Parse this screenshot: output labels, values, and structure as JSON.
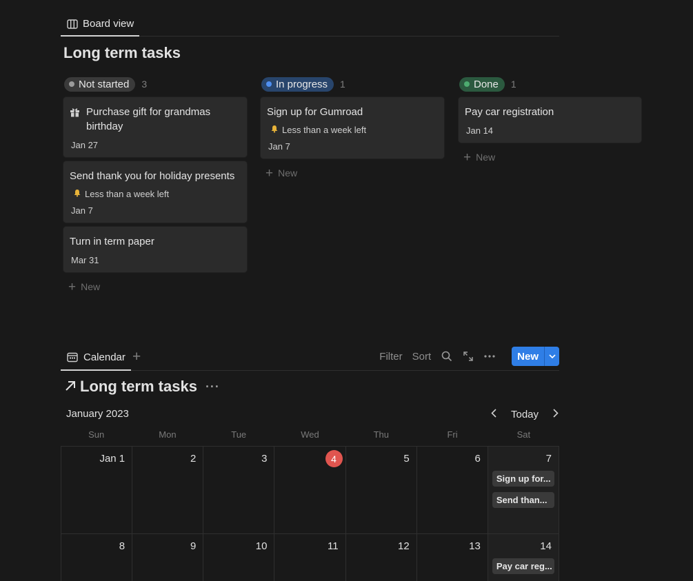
{
  "board": {
    "tab_label": "Board view",
    "title": "Long term tasks",
    "new_label": "New",
    "columns": [
      {
        "status": "Not started",
        "count": "3",
        "color": "#9b9b9b",
        "cards": [
          {
            "title": "Purchase gift for grandmas birthday",
            "icon": "gift-icon",
            "tag": "",
            "date": "Jan 27"
          },
          {
            "title": "Send thank you for holiday presents",
            "icon": "",
            "tag": "Less than a week left",
            "date": "Jan 7"
          },
          {
            "title": "Turn in term paper",
            "icon": "",
            "tag": "",
            "date": "Mar 31"
          }
        ]
      },
      {
        "status": "In progress",
        "count": "1",
        "color": "#4f8ff0",
        "cards": [
          {
            "title": "Sign up for Gumroad",
            "icon": "",
            "tag": "Less than a week left",
            "date": "Jan 7"
          }
        ]
      },
      {
        "status": "Done",
        "count": "1",
        "color": "#4dab70",
        "cards": [
          {
            "title": "Pay car registration",
            "icon": "",
            "tag": "",
            "date": "Jan 14"
          }
        ]
      }
    ]
  },
  "calendar": {
    "tab_label": "Calendar",
    "toolbar": {
      "filter": "Filter",
      "sort": "Sort",
      "new": "New"
    },
    "title": "Long term tasks",
    "month": "January 2023",
    "today_label": "Today",
    "weekdays": [
      "Sun",
      "Mon",
      "Tue",
      "Wed",
      "Thu",
      "Fri",
      "Sat"
    ],
    "weeks": [
      {
        "days": [
          {
            "label": "Jan 1"
          },
          {
            "label": "2"
          },
          {
            "label": "3"
          },
          {
            "label": "4",
            "today": true
          },
          {
            "label": "5"
          },
          {
            "label": "6"
          },
          {
            "label": "7",
            "events": [
              "Sign up for...",
              "Send than..."
            ]
          }
        ]
      },
      {
        "days": [
          {
            "label": "8"
          },
          {
            "label": "9"
          },
          {
            "label": "10"
          },
          {
            "label": "11"
          },
          {
            "label": "12"
          },
          {
            "label": "13"
          },
          {
            "label": "14",
            "events": [
              "Pay car reg..."
            ]
          }
        ]
      }
    ]
  }
}
